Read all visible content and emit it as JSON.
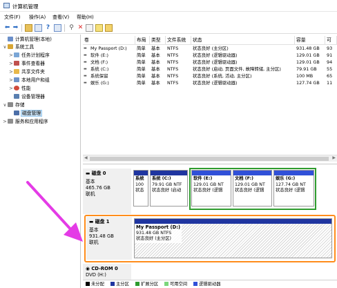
{
  "window": {
    "title": "计算机管理"
  },
  "menu": [
    "文件(F)",
    "操作(A)",
    "查看(V)",
    "帮助(H)"
  ],
  "tree": [
    {
      "label": "计算机管理(本地)",
      "level": 0,
      "expander": "",
      "icon": "computer-management-icon",
      "color": "#6b8fc9"
    },
    {
      "label": "系统工具",
      "level": 1,
      "expander": "∨",
      "icon": "system-tools-icon",
      "color": "#d8a634"
    },
    {
      "label": "任务计划程序",
      "level": 2,
      "expander": ">",
      "icon": "task-scheduler-icon",
      "color": "#7aa6d6"
    },
    {
      "label": "事件查看器",
      "level": 2,
      "expander": ">",
      "icon": "event-viewer-icon",
      "color": "#c0504d"
    },
    {
      "label": "共享文件夹",
      "level": 2,
      "expander": ">",
      "icon": "shared-folder-icon",
      "color": "#e8b84a"
    },
    {
      "label": "本地用户和组",
      "level": 2,
      "expander": ">",
      "icon": "users-icon",
      "color": "#6f93c8"
    },
    {
      "label": "性能",
      "level": 2,
      "expander": ">",
      "icon": "performance-icon",
      "color": "#d04b3c"
    },
    {
      "label": "设备管理器",
      "level": 2,
      "expander": "",
      "icon": "device-manager-icon",
      "color": "#5a7fb0"
    },
    {
      "label": "存储",
      "level": 1,
      "expander": "∨",
      "icon": "storage-icon",
      "color": "#8a8a8a"
    },
    {
      "label": "磁盘管理",
      "level": 2,
      "expander": "",
      "icon": "disk-management-icon",
      "color": "#4c6fa8",
      "selected": true
    },
    {
      "label": "服务和应用程序",
      "level": 1,
      "expander": ">",
      "icon": "services-icon",
      "color": "#8e8e8e"
    }
  ],
  "columns": [
    "卷",
    "布局",
    "类型",
    "文件系统",
    "状态",
    "容量",
    "可"
  ],
  "volumes": [
    [
      "My Passport (D:)",
      "简单",
      "基本",
      "NTFS",
      "状态良好 (主分区)",
      "931.48 GB",
      "93"
    ],
    [
      "软件 (E:)",
      "简单",
      "基本",
      "NTFS",
      "状态良好 (逻辑驱动器)",
      "129.01 GB",
      "91"
    ],
    [
      "文档 (F:)",
      "简单",
      "基本",
      "NTFS",
      "状态良好 (逻辑驱动器)",
      "129.01 GB",
      "94"
    ],
    [
      "系统 (C:)",
      "简单",
      "基本",
      "NTFS",
      "状态良好 (启动, 页面文件, 故障转储, 主分区)",
      "79.91 GB",
      "55"
    ],
    [
      "系统保留",
      "简单",
      "基本",
      "NTFS",
      "状态良好 (系统, 活动, 主分区)",
      "100 MB",
      "65"
    ],
    [
      "娱乐 (G:)",
      "简单",
      "基本",
      "NTFS",
      "状态良好 (逻辑驱动器)",
      "127.74 GB",
      "11"
    ]
  ],
  "disks": [
    {
      "name": "磁盘 0",
      "type": "基本",
      "size": "465.76 GB",
      "status": "联机",
      "partitions": [
        {
          "name": "系统",
          "size": "100",
          "status": "状态"
        },
        {
          "name": "系统 (C:)",
          "size": "79.91 GB NTF",
          "status": "状态良好 (启动"
        },
        {
          "name": "软件 (E:)",
          "size": "129.01 GB NT",
          "status": "状态良好 (逻辑"
        },
        {
          "name": "文档 (F:)",
          "size": "129.01 GB NT",
          "status": "状态良好 (逻辑"
        },
        {
          "name": "娱乐 (G:)",
          "size": "127.74 GB NT",
          "status": "状态良好 (逻辑"
        }
      ]
    },
    {
      "name": "磁盘 1",
      "type": "基本",
      "size": "931.48 GB",
      "status": "联机",
      "partitions": [
        {
          "name": "My Passport (D:)",
          "size": "931.48 GB NTFS",
          "status": "状态良好 (主分区)"
        }
      ]
    },
    {
      "name": "CD-ROM 0",
      "type": "DVD (H:)"
    }
  ],
  "legend": [
    {
      "label": "未分配",
      "color": "#000000"
    },
    {
      "label": "主分区",
      "color": "#1f35a0"
    },
    {
      "label": "扩展分区",
      "color": "#2e9b2e"
    },
    {
      "label": "可用空间",
      "color": "#7cd67c"
    },
    {
      "label": "逻辑驱动器",
      "color": "#3050d8"
    }
  ],
  "colors": {
    "selection_highlight": "#ff8c1a",
    "extended_partition": "#2e9b2e",
    "arrow": "#e43be6"
  }
}
